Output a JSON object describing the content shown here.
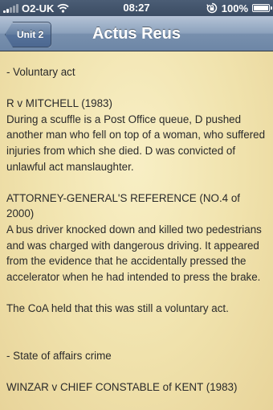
{
  "status_bar": {
    "carrier": "O2-UK",
    "time": "08:27",
    "battery": "100%",
    "battery_level": 1.0,
    "signal_bars": 2,
    "icons": [
      "signal-icon",
      "wifi-icon",
      "orientation-lock-icon",
      "battery-icon"
    ]
  },
  "nav": {
    "back_label": "Unit 2",
    "title": "Actus Reus"
  },
  "content": {
    "heading_voluntary": "- Voluntary act",
    "case1_title": "R v MITCHELL (1983)",
    "case1_body": "During a scuffle is a Post Office queue, D pushed another man who fell on top of a woman, who suffered injuries from which she died. D was convicted of unlawful act manslaughter.",
    "case2_title": "ATTORNEY-GENERAL'S REFERENCE (NO.4 of 2000)",
    "case2_body": "A bus driver knocked down and killed two pedestrians and was charged with dangerous driving. It appeared from the evidence that he accidentally pressed the accelerator when he had intended to press the brake.",
    "case2_holding": "The CoA held that this was still a voluntary act.",
    "heading_state": "- State of affairs crime",
    "case3_title": "WINZAR v CHIEF CONSTABLE of KENT (1983)"
  }
}
